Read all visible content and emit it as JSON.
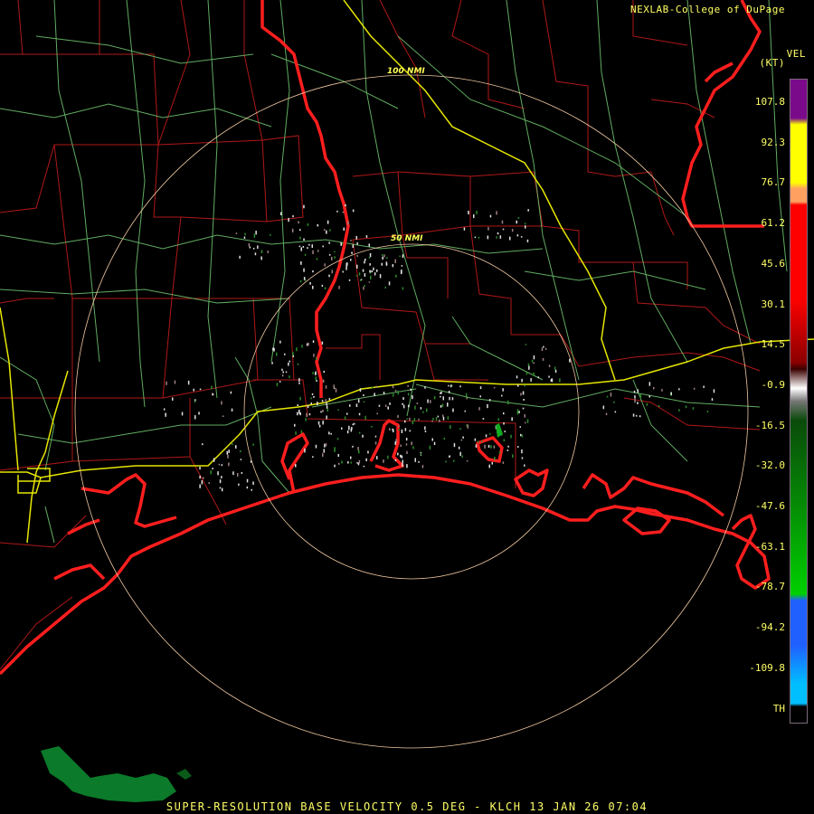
{
  "credit": "NEXLAB-College of DuPage",
  "title": "SUPER-RESOLUTION BASE VELOCITY 0.5 DEG - KLCH 13 JAN 26 07:04",
  "legend": {
    "product": "VEL",
    "unit": "(KT)",
    "ticks": [
      "107.8",
      "92.3",
      "76.7",
      "61.2",
      "45.6",
      "30.1",
      "14.5",
      "-0.9",
      "-16.5",
      "-32.0",
      "-47.6",
      "-63.1",
      "-78.7",
      "-94.2",
      "-109.8",
      "TH"
    ],
    "colors": {
      "purple": "#7a0a8a",
      "yellow": "#ffff00",
      "orange": "#ffa060",
      "red": "#ff0000",
      "darkred": "#8b0000",
      "white": "#ffffff",
      "green": "#00d000",
      "darkgreen": "#0a4a0a",
      "blue": "#2060ff",
      "cyan": "#00bfff"
    }
  },
  "range_rings": [
    {
      "label": "100 NMI",
      "range_nmi": 100
    },
    {
      "label": "50 NMI",
      "range_nmi": 50
    }
  ],
  "colors": {
    "state_border": "#ff2020",
    "county": "#c01818",
    "highway": "#e8e800",
    "road": "#78c878",
    "ring": "#f0c8a0",
    "background": "#000000"
  }
}
